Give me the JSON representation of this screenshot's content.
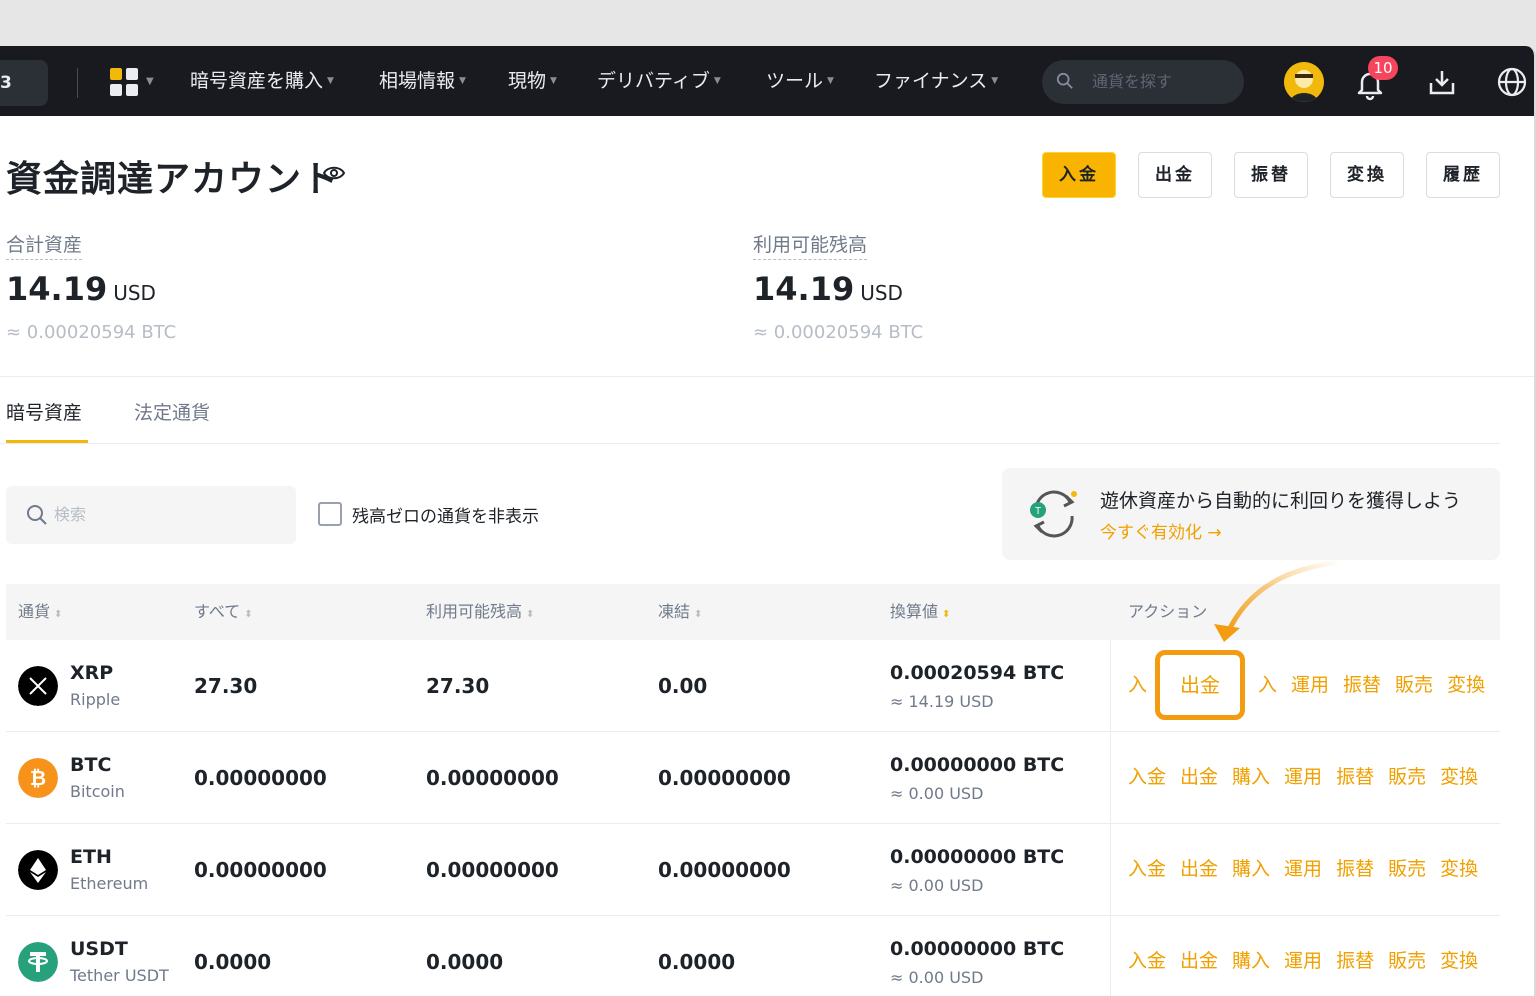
{
  "topbar": {
    "left_pill": "3",
    "nav": [
      "暗号資産を購入",
      "相場情報",
      "現物",
      "デリバティブ",
      "ツール",
      "ファイナンス"
    ],
    "search_placeholder": "通貨を探す",
    "notification_count": "10"
  },
  "page": {
    "title": "資金調達アカウント",
    "buttons": [
      "入金",
      "出金",
      "振替",
      "変換",
      "履歴"
    ]
  },
  "summary": {
    "total": {
      "label": "合計資産",
      "value": "14.19",
      "unit": "USD",
      "approx": "≈ 0.00020594 BTC"
    },
    "available": {
      "label": "利用可能残高",
      "value": "14.19",
      "unit": "USD",
      "approx": "≈ 0.00020594 BTC"
    }
  },
  "tabs": [
    "暗号資産",
    "法定通貨"
  ],
  "filters": {
    "search_placeholder": "検索",
    "hide_zero_label": "残高ゼロの通貨を非表示"
  },
  "promo": {
    "title": "遊休資産から自動的に利回りを獲得しよう",
    "link": "今すぐ有効化 →"
  },
  "table": {
    "headers": [
      "通貨",
      "すべて",
      "利用可能残高",
      "凍結",
      "換算値",
      "アクション"
    ],
    "rows": [
      {
        "symbol": "XRP",
        "name": "Ripple",
        "total": "27.30",
        "available": "27.30",
        "frozen": "0.00",
        "btc": "0.00020594 BTC",
        "usd": "≈ 14.19 USD",
        "color": "#000000"
      },
      {
        "symbol": "BTC",
        "name": "Bitcoin",
        "total": "0.00000000",
        "available": "0.00000000",
        "frozen": "0.00000000",
        "btc": "0.00000000 BTC",
        "usd": "≈ 0.00 USD",
        "color": "#f7931a"
      },
      {
        "symbol": "ETH",
        "name": "Ethereum",
        "total": "0.00000000",
        "available": "0.00000000",
        "frozen": "0.00000000",
        "btc": "0.00000000 BTC",
        "usd": "≈ 0.00 USD",
        "color": "#000000"
      },
      {
        "symbol": "USDT",
        "name": "Tether USDT",
        "total": "0.0000",
        "available": "0.0000",
        "frozen": "0.0000",
        "btc": "0.00000000 BTC",
        "usd": "≈ 0.00 USD",
        "color": "#26a17b"
      }
    ],
    "actions": [
      "入金",
      "出金",
      "購入",
      "運用",
      "振替",
      "販売",
      "変換"
    ],
    "xrp_actions": [
      "入",
      "入",
      "運用",
      "振替",
      "販売",
      "変換"
    ]
  },
  "highlight": {
    "label": "出金"
  },
  "colors": {
    "accent": "#f0b90b",
    "action": "#f0a000",
    "highlight_border": "#f39c12",
    "topbar": "#181a20"
  }
}
